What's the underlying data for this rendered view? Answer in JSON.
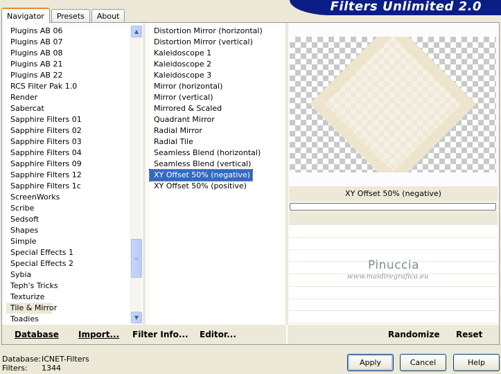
{
  "window": {
    "banner_title": "Filters Unlimited 2.0"
  },
  "tabs": [
    {
      "label": "Navigator",
      "active": true
    },
    {
      "label": "Presets",
      "active": false
    },
    {
      "label": "About",
      "active": false
    }
  ],
  "categories": [
    "Plugins AB 06",
    "Plugins AB 07",
    "Plugins AB 08",
    "Plugins AB 21",
    "Plugins AB 22",
    "RCS Filter Pak 1.0",
    "Render",
    "Sabercat",
    "Sapphire Filters 01",
    "Sapphire Filters 02",
    "Sapphire Filters 03",
    "Sapphire Filters 04",
    "Sapphire Filters 09",
    "Sapphire Filters 12",
    "Sapphire Filters 1c",
    "ScreenWorks",
    "Scribe",
    "Sedsoft",
    "Shapes",
    "Simple",
    "Special Effects 1",
    "Special Effects 2",
    "Sybia",
    "Teph's Tricks",
    "Texturize",
    "Tile & Mirror",
    "Toadies"
  ],
  "selected_category": "Tile & Mirror",
  "filters": [
    "Distortion Mirror (horizontal)",
    "Distortion Mirror (vertical)",
    "Kaleidoscope 1",
    "Kaleidoscope 2",
    "Kaleidoscope 3",
    "Mirror (horizontal)",
    "Mirror (vertical)",
    "Mirrored & Scaled",
    "Quadrant Mirror",
    "Radial Mirror",
    "Radial Tile",
    "Seamless Blend (horizontal)",
    "Seamless Blend (vertical)",
    "XY Offset 50% (negative)",
    "XY Offset 50% (positive)"
  ],
  "selected_filter": "XY Offset 50% (negative)",
  "preview": {
    "filter_name": "XY Offset 50% (negative)",
    "progress": 0
  },
  "watermark": {
    "name": "Pinuccia",
    "site": "www.maidiregrafica.eu"
  },
  "toolbar": {
    "database_label": "Database",
    "import_label": "Import...",
    "filter_info_label": "Filter Info...",
    "editor_label": "Editor...",
    "randomize_label": "Randomize",
    "reset_label": "Reset"
  },
  "status": {
    "database_label": "Database:",
    "database_value": "ICNET-Filters",
    "filters_label": "Filters:",
    "filters_value": "1344"
  },
  "buttons": {
    "apply": "Apply",
    "cancel": "Cancel",
    "help": "Help"
  }
}
